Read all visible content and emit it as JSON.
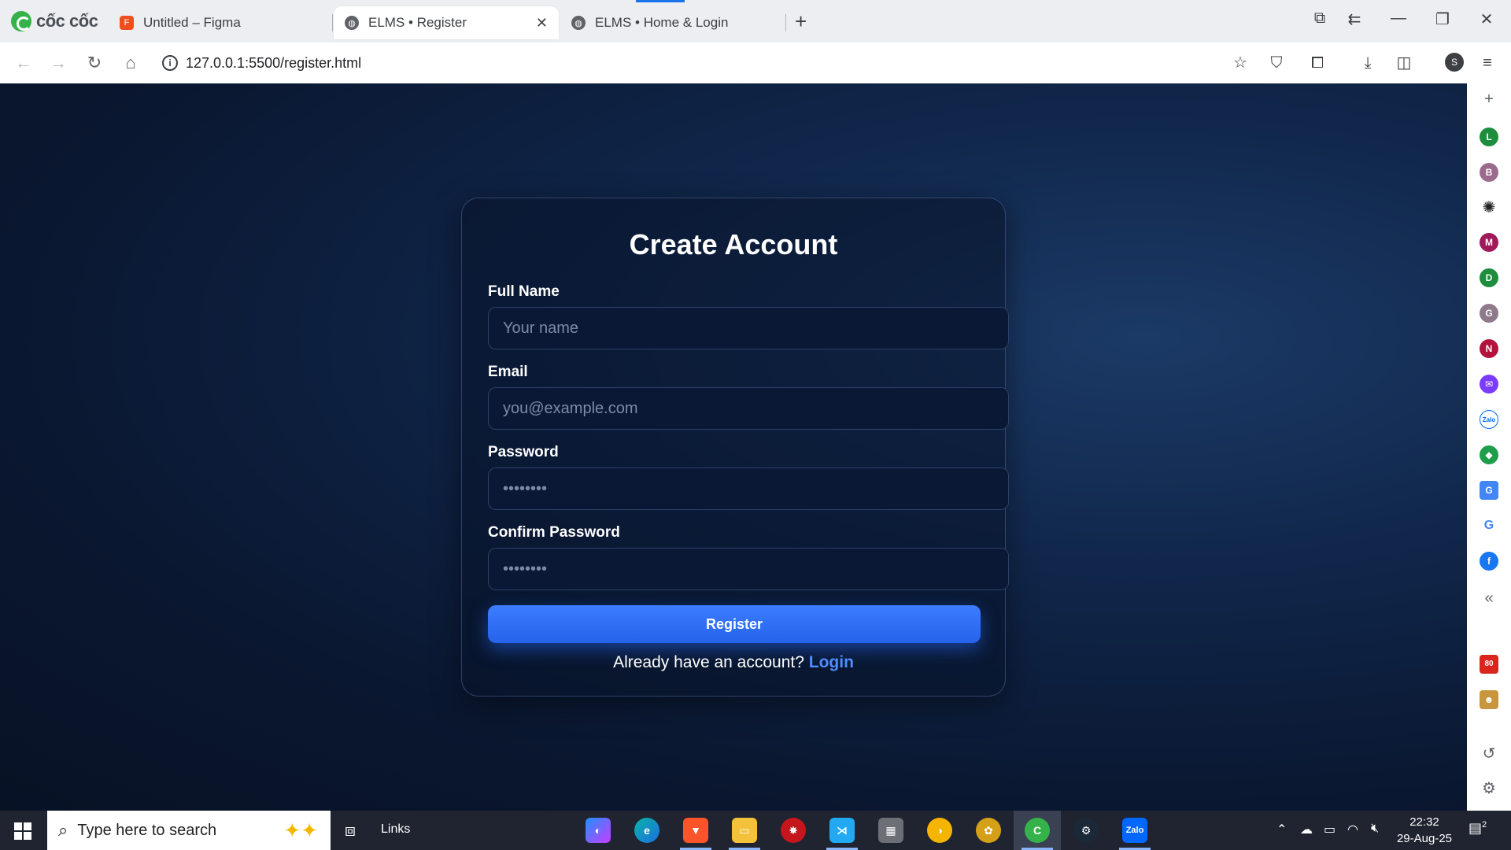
{
  "browser": {
    "brand": "cốc cốc",
    "tabs": [
      {
        "title": "Untitled – Figma",
        "active": false
      },
      {
        "title": "ELMS • Register",
        "active": true
      },
      {
        "title": "ELMS • Home & Login",
        "active": false
      }
    ],
    "url": "127.0.0.1:5500/register.html"
  },
  "page": {
    "title": "Create Account",
    "fields": [
      {
        "label": "Full Name",
        "placeholder": "Your name",
        "type": "text"
      },
      {
        "label": "Email",
        "placeholder": "you@example.com",
        "type": "email"
      },
      {
        "label": "Password",
        "placeholder": "••••••••",
        "type": "password"
      },
      {
        "label": "Confirm Password",
        "placeholder": "••••••••",
        "type": "password"
      }
    ],
    "register_label": "Register",
    "login_prompt": "Already have an account?",
    "login_link": "Login"
  },
  "side_panel": {
    "avatars": [
      {
        "letter": "L",
        "color": "#1e8e3e"
      },
      {
        "letter": "B",
        "color": "#9b6b8e"
      },
      {
        "letter": "M",
        "color": "#a01a5a"
      },
      {
        "letter": "D",
        "color": "#1e8e3e"
      },
      {
        "letter": "G",
        "color": "#8e7a8a"
      },
      {
        "letter": "N",
        "color": "#b3123c"
      }
    ],
    "icons": [
      "openai-icon",
      "messenger-icon",
      "zalo-icon",
      "game-icon",
      "translate-icon",
      "google-icon",
      "facebook-icon"
    ]
  },
  "taskbar": {
    "search_placeholder": "Type here to search",
    "links_label": "Links",
    "time": "22:32",
    "date": "29-Aug-25",
    "notification_count": "2"
  }
}
